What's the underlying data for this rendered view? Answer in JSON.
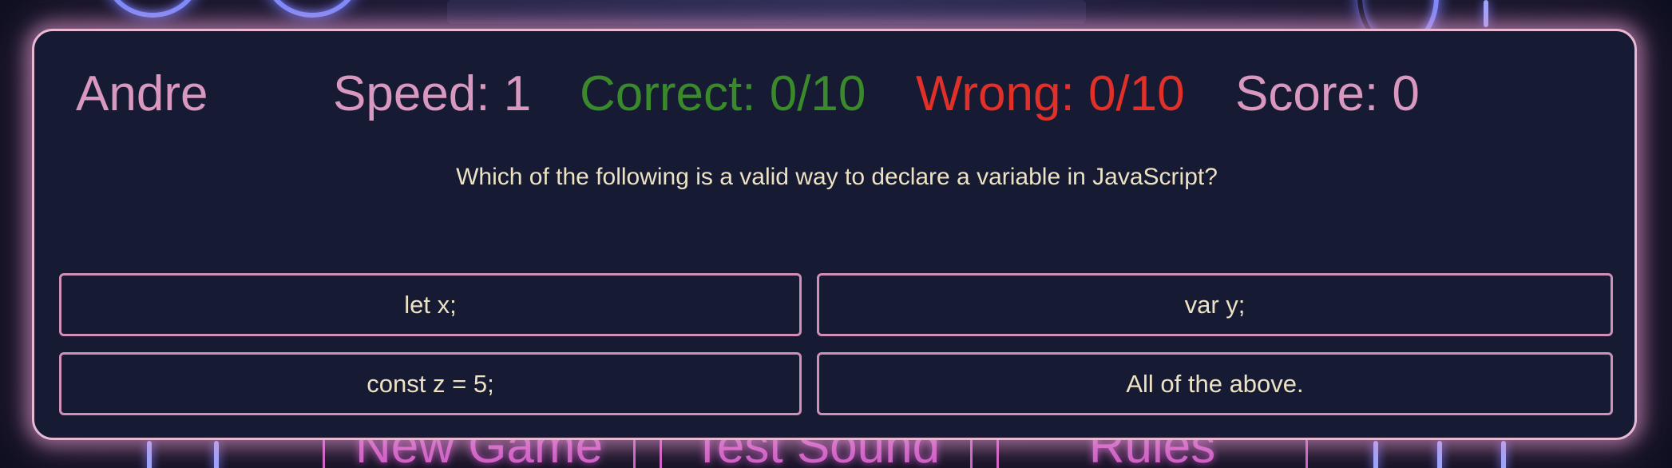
{
  "background": {
    "menu": [
      {
        "label": "New Game"
      },
      {
        "label": "Test Sound"
      },
      {
        "label": "Rules"
      }
    ]
  },
  "player": {
    "name": "Andre"
  },
  "stats": {
    "speed": "Speed: 1",
    "correct": "Correct: 0/10",
    "wrong": "Wrong: 0/10",
    "score": "Score: 0"
  },
  "question": {
    "text": "Which of the following is a valid way to declare a variable in JavaScript?"
  },
  "answers": [
    {
      "label": "let x;"
    },
    {
      "label": "var y;"
    },
    {
      "label": "const z = 5;"
    },
    {
      "label": "All of the above."
    }
  ],
  "colors": {
    "panel_bg": "#171a33",
    "panel_border": "#e8b8d4",
    "stat_pink": "#d898c0",
    "correct_green": "#3a8a2c",
    "wrong_red": "#e03028",
    "question_text": "#ece2c4",
    "answer_border": "#cf8fb6"
  }
}
